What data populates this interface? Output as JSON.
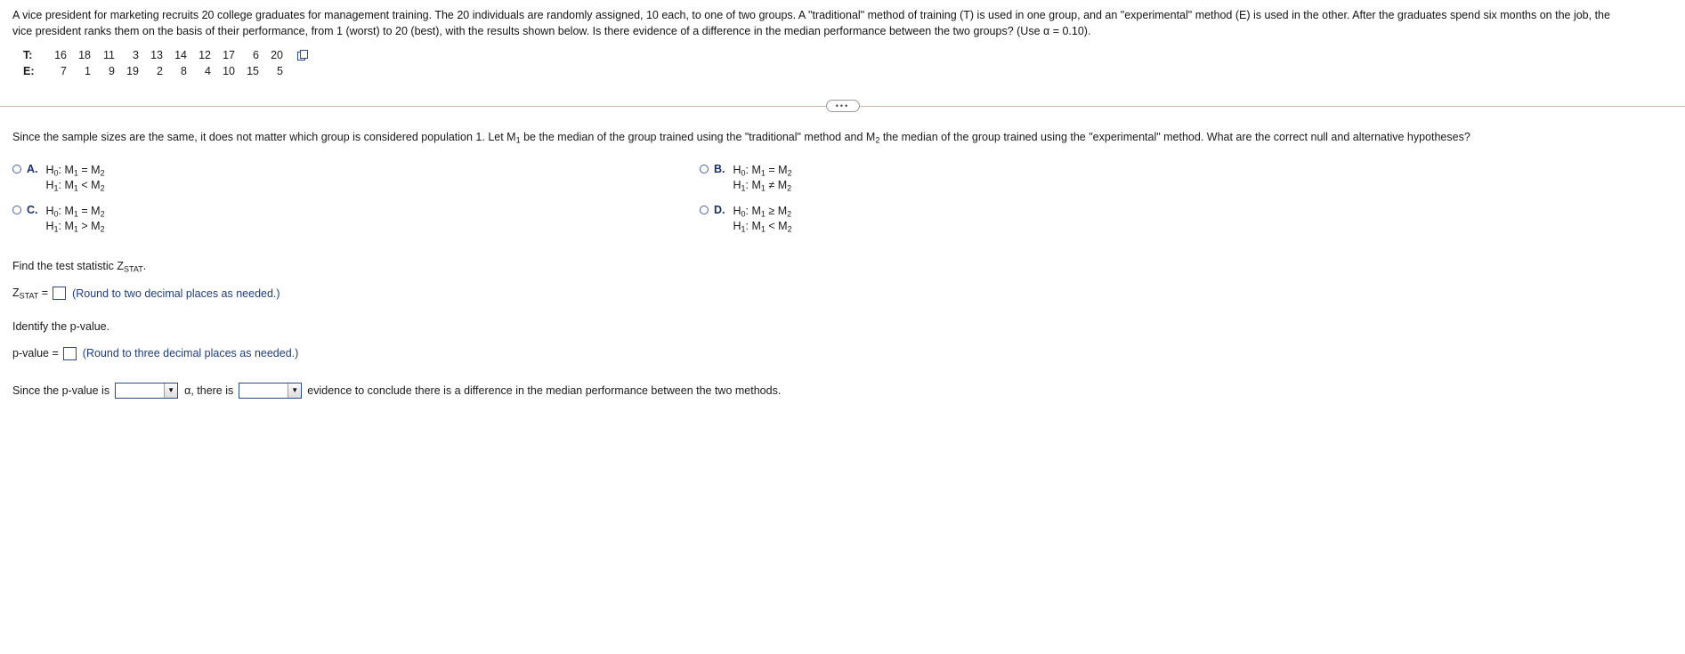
{
  "problem": {
    "line1": "A vice president for marketing recruits 20 college graduates for management training. The 20 individuals are randomly assigned, 10 each, to one of two groups. A \"traditional\" method of training (T) is used in one group, and an \"experimental\" method (E) is used in the other. After the graduates spend six months on the job, the",
    "line2": "vice president ranks them on the basis of their performance, from 1 (worst) to 20 (best), with the results shown below. Is there evidence of a difference in the median performance between the two groups? (Use α = 0.10)."
  },
  "data_table": {
    "rows": [
      {
        "label": "T:",
        "values": [
          16,
          18,
          11,
          3,
          13,
          14,
          12,
          17,
          6,
          20
        ]
      },
      {
        "label": "E:",
        "values": [
          7,
          1,
          9,
          19,
          2,
          8,
          4,
          10,
          15,
          5
        ]
      }
    ],
    "copy_icon": "copy-icon"
  },
  "divider": {
    "handle_label": "•••"
  },
  "question": {
    "intro_part1": "Since the sample sizes are the same, it does not matter which group is considered population 1. Let M",
    "intro_sub1": "1",
    "intro_part2": " be the median of the group trained using the \"traditional\" method and M",
    "intro_sub2": "2",
    "intro_part3": " the median of the group trained using the \"experimental\" method. What are the correct null and alternative hypotheses?"
  },
  "options": {
    "left": [
      {
        "letter": "A.",
        "null_prefix": "H",
        "null_sub": "0",
        "null_rest": ": M",
        "null_sub1": "1",
        "null_op": " = M",
        "null_sub2": "2",
        "alt_prefix": "H",
        "alt_sub": "1",
        "alt_rest": ": M",
        "alt_sub1": "1",
        "alt_op": " < M",
        "alt_sub2": "2"
      },
      {
        "letter": "C.",
        "null_prefix": "H",
        "null_sub": "0",
        "null_rest": ": M",
        "null_sub1": "1",
        "null_op": " = M",
        "null_sub2": "2",
        "alt_prefix": "H",
        "alt_sub": "1",
        "alt_rest": ": M",
        "alt_sub1": "1",
        "alt_op": " > M",
        "alt_sub2": "2"
      }
    ],
    "right": [
      {
        "letter": "B.",
        "null_prefix": "H",
        "null_sub": "0",
        "null_rest": ": M",
        "null_sub1": "1",
        "null_op": " = M",
        "null_sub2": "2",
        "alt_prefix": "H",
        "alt_sub": "1",
        "alt_rest": ": M",
        "alt_sub1": "1",
        "alt_op": " ≠ M",
        "alt_sub2": "2"
      },
      {
        "letter": "D.",
        "null_prefix": "H",
        "null_sub": "0",
        "null_rest": ": M",
        "null_sub1": "1",
        "null_op": " ≥ M",
        "null_sub2": "2",
        "alt_prefix": "H",
        "alt_sub": "1",
        "alt_rest": ": M",
        "alt_sub1": "1",
        "alt_op": " < M",
        "alt_sub2": "2"
      }
    ]
  },
  "test_statistic": {
    "prompt_part1": "Find the test statistic Z",
    "prompt_sub": "STAT",
    "prompt_part2": ".",
    "label_part1": "Z",
    "label_sub": "STAT",
    "label_eq": " =",
    "value": "",
    "hint": "(Round to two decimal places as needed.)"
  },
  "p_value": {
    "prompt": "Identify the p-value.",
    "label": "p-value =",
    "value": "",
    "hint": "(Round to three decimal places as needed.)"
  },
  "conclusion": {
    "text_start": "Since the p-value is",
    "dropdown1_value": "",
    "dropdown1_arrow": "▼",
    "text_middle_alpha": "α, there is",
    "dropdown2_value": "",
    "dropdown2_arrow": "▼",
    "text_end": "evidence to conclude there is a difference in the median performance between the two methods."
  }
}
